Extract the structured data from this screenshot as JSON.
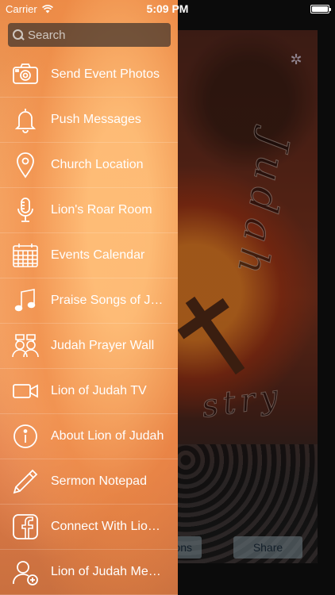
{
  "status_bar": {
    "carrier": "Carrier",
    "time": "5:09 PM",
    "battery_level": 1.0
  },
  "search": {
    "placeholder": "Search"
  },
  "menu": {
    "items": [
      {
        "label": "Send Event Photos",
        "icon": "camera-icon"
      },
      {
        "label": "Push Messages",
        "icon": "bell-icon"
      },
      {
        "label": "Church Location",
        "icon": "map-pin-icon"
      },
      {
        "label": "Lion's Roar Room",
        "icon": "microphone-icon"
      },
      {
        "label": "Events Calendar",
        "icon": "calendar-icon"
      },
      {
        "label": "Praise Songs of Judah",
        "icon": "music-note-icon"
      },
      {
        "label": "Judah Prayer Wall",
        "icon": "people-chat-icon"
      },
      {
        "label": "Lion of Judah TV",
        "icon": "video-camera-icon"
      },
      {
        "label": "About Lion of Judah",
        "icon": "info-icon"
      },
      {
        "label": "Sermon Notepad",
        "icon": "pencil-icon"
      },
      {
        "label": "Connect With Lion of Judah",
        "icon": "facebook-icon"
      },
      {
        "label": "Lion of Judah Members",
        "icon": "add-user-icon"
      }
    ]
  },
  "background": {
    "title_fragment": "Judah",
    "subtitle_fragment": "stry",
    "left_button_label": "ons",
    "share_button_label": "Share"
  }
}
